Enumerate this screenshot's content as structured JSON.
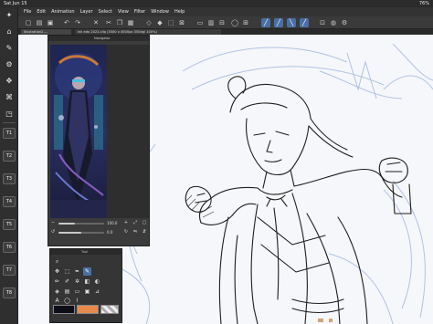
{
  "status_bar": {
    "time": "Sat Jun 15",
    "battery": "76%"
  },
  "menu": [
    "File",
    "Edit",
    "Animation",
    "Layer",
    "Select",
    "View",
    "Filter",
    "Window",
    "Help"
  ],
  "left_sidebar": {
    "top_items": [
      {
        "glyph": "✦",
        "label": ""
      },
      {
        "glyph": "⌂",
        "label": ""
      },
      {
        "glyph": "✎",
        "label": ""
      },
      {
        "glyph": "⚙",
        "label": ""
      },
      {
        "glyph": "✥",
        "label": ""
      },
      {
        "glyph": "⌘",
        "label": ""
      },
      {
        "glyph": "◳",
        "label": ""
      }
    ],
    "buttons": [
      "T1",
      "T2",
      "T3",
      "T4",
      "T5",
      "T6",
      "T7",
      "T8"
    ]
  },
  "tabs": [
    "Illustration2-...",
    "ink edo 2022.clip (3500 x 4500px 350dpi 100%)"
  ],
  "navigator": {
    "title": "Navigator",
    "zoom_value": "100.0",
    "rotation_value": "0.0",
    "zoom_fraction": 0.35,
    "rotation_fraction": 0.5
  },
  "tool_panel": {
    "title": "Tool",
    "main_color": "#0d0d1a",
    "sub_color": "#e88a4d",
    "transparent_label": ""
  },
  "accent_color": "#4a6fa5"
}
